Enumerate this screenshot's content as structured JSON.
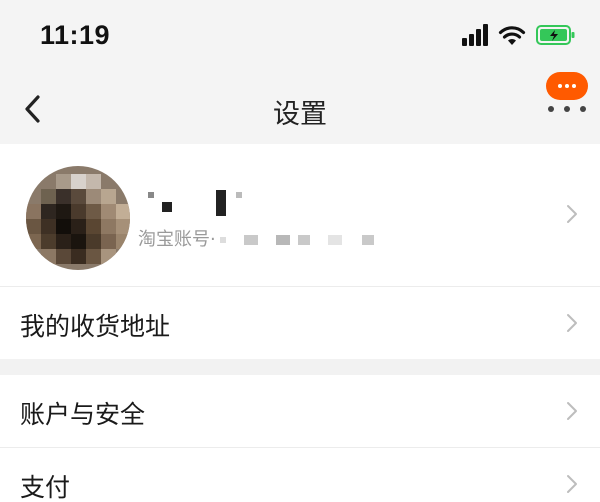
{
  "status_bar": {
    "time": "11:19",
    "icons": [
      "signal-icon",
      "wifi-icon",
      "battery-charging-icon"
    ],
    "battery_color": "#34c759"
  },
  "nav": {
    "title": "设置",
    "back_icon": "chevron-left-icon",
    "more_icon": "more-dots-icon",
    "accent_color": "#ff5a00"
  },
  "profile": {
    "account_label": "淘宝账号·",
    "username_hidden": true,
    "avatar_pixelated": true
  },
  "settings_rows": [
    {
      "label": "我的收货地址"
    },
    {
      "label": "账户与安全"
    },
    {
      "label": "支付"
    }
  ]
}
